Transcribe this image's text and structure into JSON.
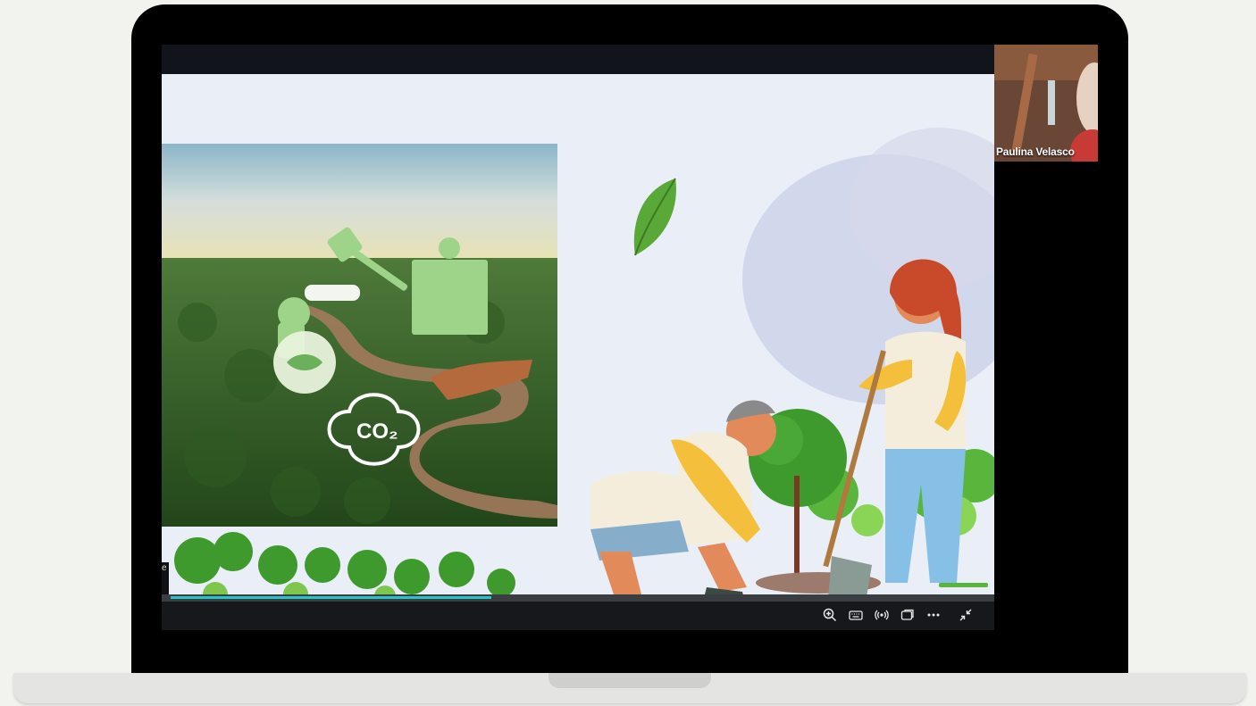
{
  "participant": {
    "name": "Paulina Velasco"
  },
  "slide_side_tag": "e",
  "slide": {
    "co2_label": "CO₂"
  },
  "playback": {
    "progress": 0.385
  },
  "controls": [
    {
      "id": "zoom",
      "icon": "zoom-in-icon"
    },
    {
      "id": "captions",
      "icon": "keyboard-icon"
    },
    {
      "id": "broadcast",
      "icon": "broadcast-icon"
    },
    {
      "id": "popout",
      "icon": "popout-icon"
    },
    {
      "id": "more",
      "icon": "more-icon"
    },
    {
      "id": "exit-fullscreen",
      "icon": "exit-fullscreen-icon"
    }
  ],
  "colors": {
    "progress": "#25c6c9",
    "slide_bg": "#e9eef7",
    "leaf_green": "#5aa838"
  }
}
